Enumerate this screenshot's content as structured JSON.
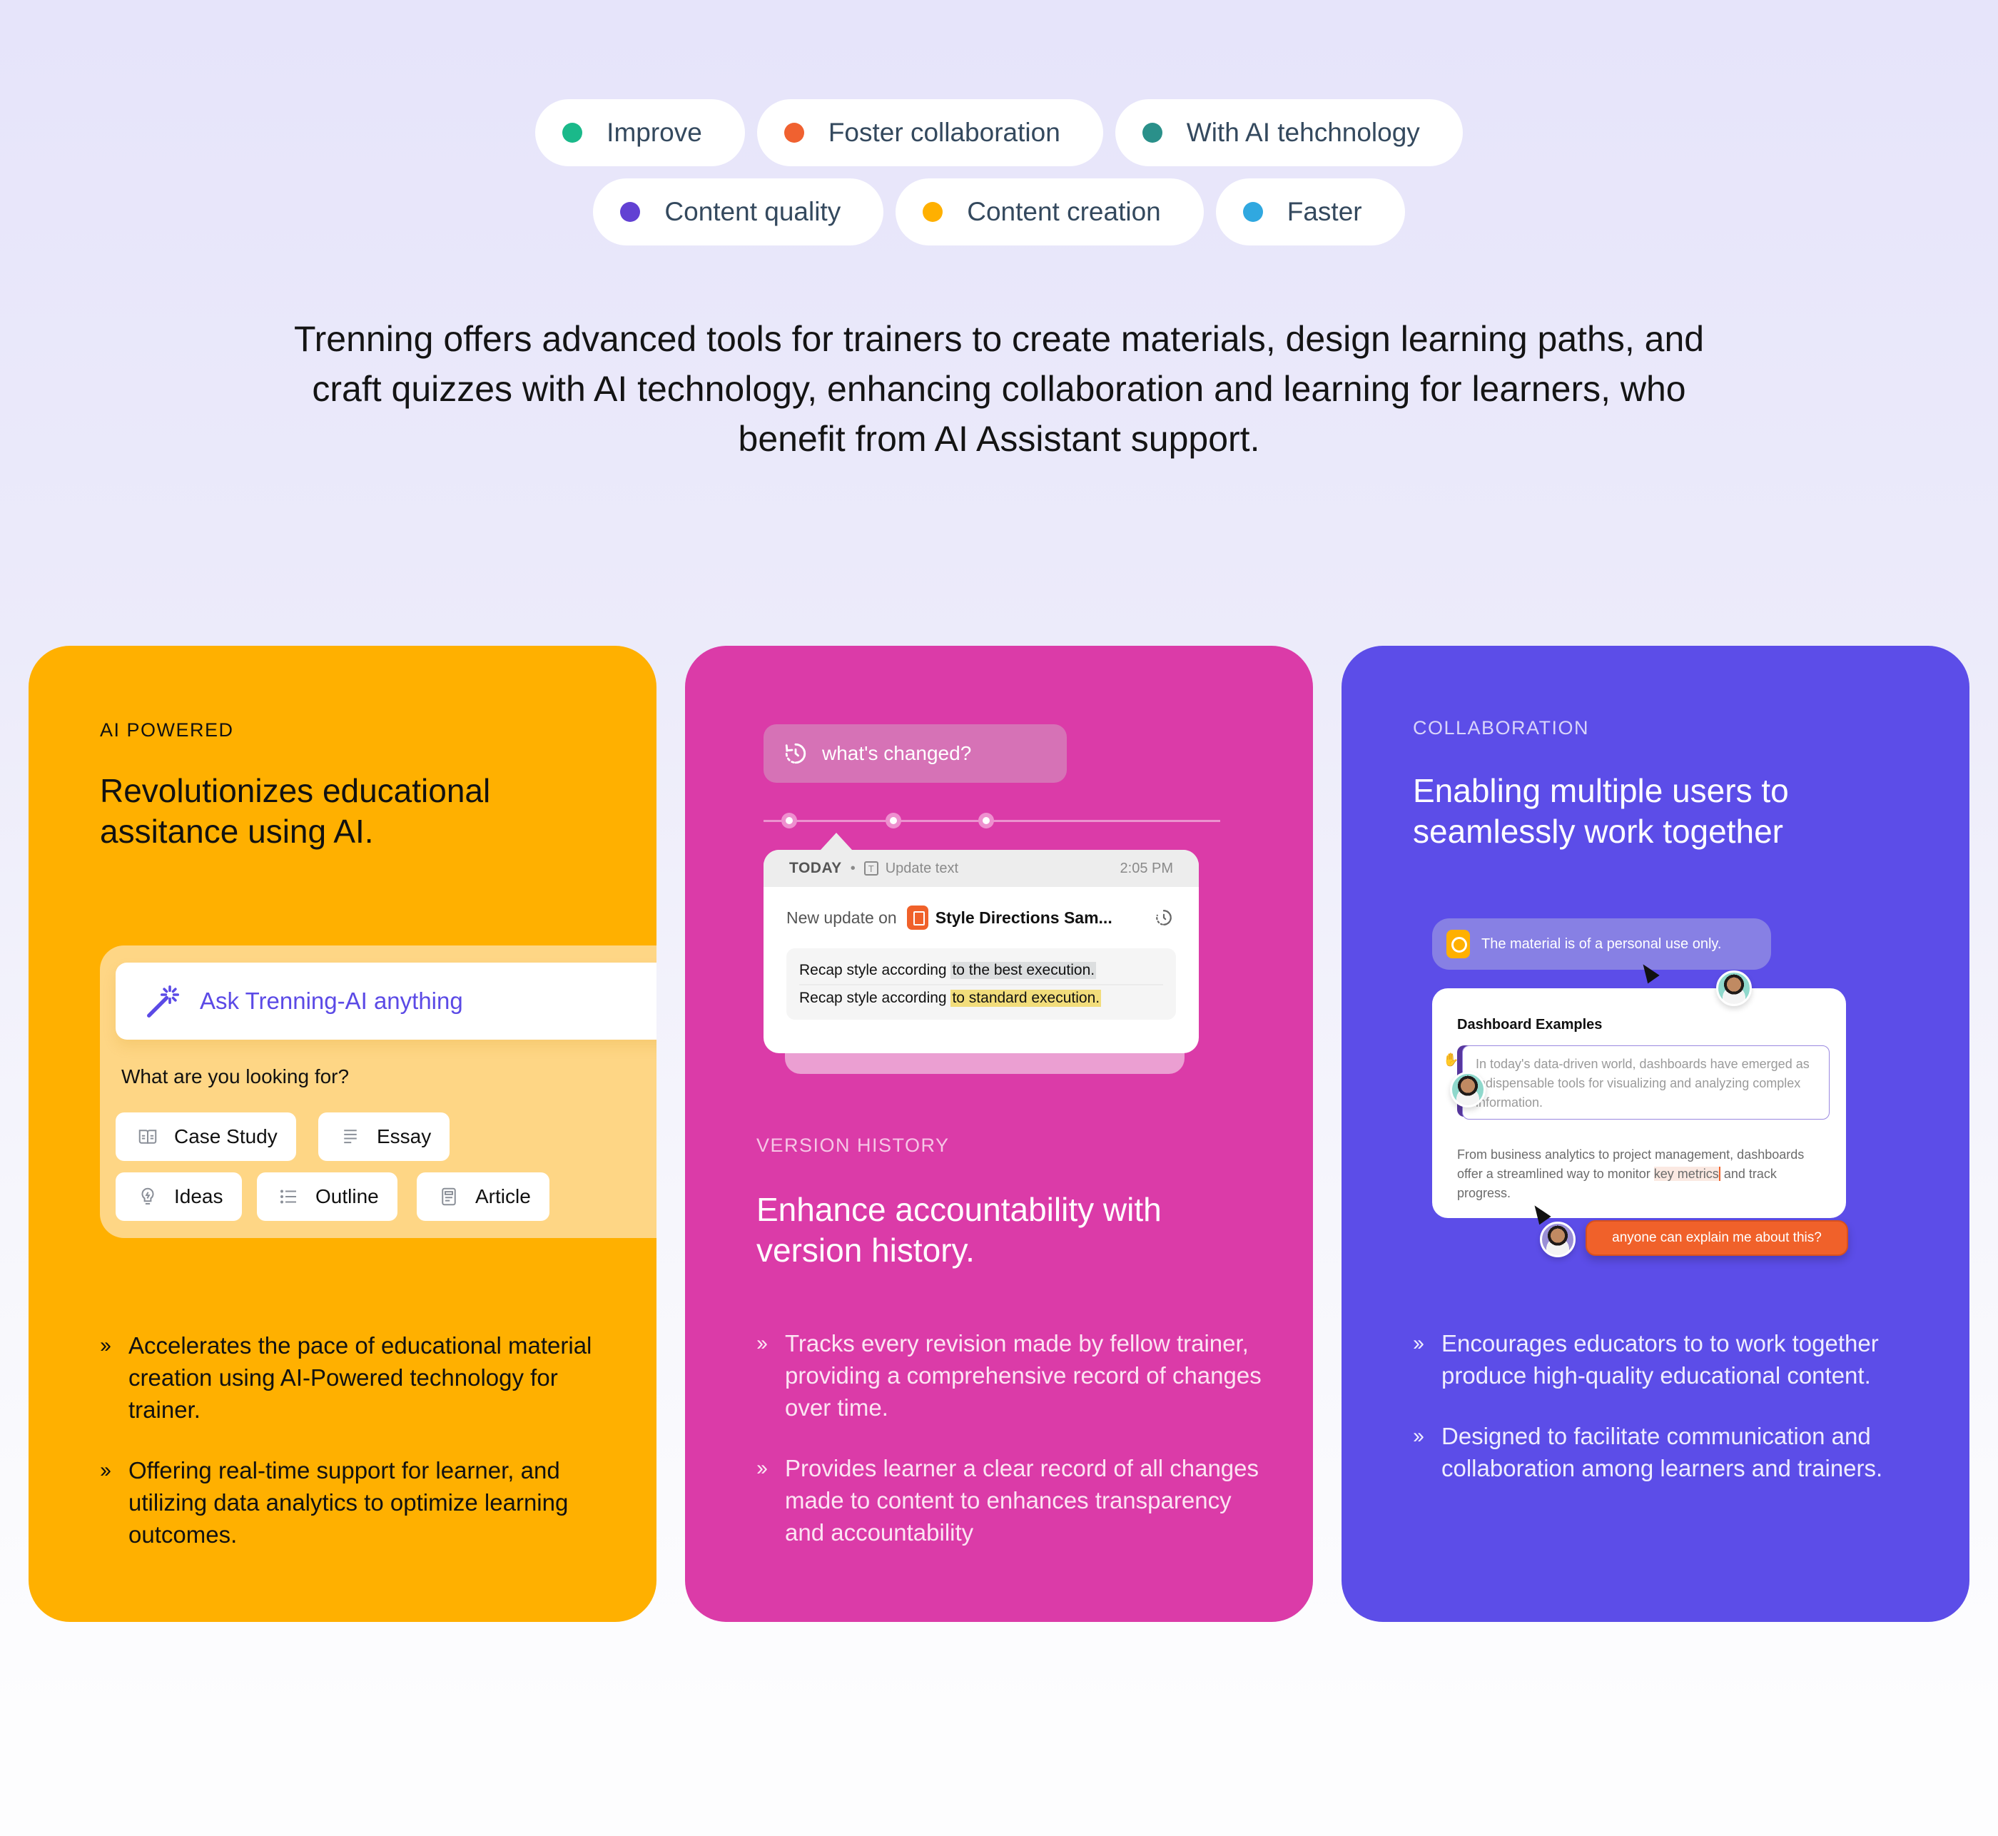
{
  "tags": {
    "row1": [
      {
        "label": "Improve",
        "color": "#1AB98A"
      },
      {
        "label": "Foster collaboration",
        "color": "#F06130"
      },
      {
        "label": "With AI tehchnology",
        "color": "#2A908A"
      }
    ],
    "row2": [
      {
        "label": "Content quality",
        "color": "#6241D3"
      },
      {
        "label": "Content creation",
        "color": "#FFB000"
      },
      {
        "label": "Faster",
        "color": "#30A8E0"
      }
    ]
  },
  "intro": "Trenning offers advanced tools for trainers to create materials, design learning paths, and craft quizzes with AI technology, enhancing collaboration and learning for learners, who benefit from AI Assistant support.",
  "cards": {
    "ai": {
      "color": "#FFB000",
      "eyebrow": "AI POWERED",
      "headline": "Revolutionizes educational assitance using AI.",
      "input_placeholder": "Ask Trenning-AI anything",
      "question": "What are you looking for?",
      "chips": [
        "Case Study",
        "Essay",
        "Ideas",
        "Outline",
        "Article"
      ],
      "bullets": [
        "Accelerates the pace of educational material creation using AI-Powered technology for trainer.",
        "Offering real-time support for learner, and utilizing data analytics to optimize learning outcomes."
      ]
    },
    "version": {
      "color": "#DB3BA8",
      "whats_changed": "what's changed?",
      "entry": {
        "day": "TODAY",
        "action": "Update text",
        "time": "2:05 PM",
        "prefix": "New update on",
        "doc_title": "Style Directions Sam...",
        "old_base": "Recap style according ",
        "old_highlight": "to the best execution.",
        "new_base": "Recap style according ",
        "new_highlight": "to standard execution."
      },
      "eyebrow": "VERSION HISTORY",
      "headline": "Enhance accountability with version history.",
      "bullets": [
        "Tracks every revision made by fellow trainer, providing a comprehensive record of changes over time.",
        "Provides learner a clear record of all changes made to content to enhances transparency and accountability"
      ]
    },
    "collab": {
      "color": "#5C4DE8",
      "eyebrow": "COLLABORATION",
      "headline": "Enabling multiple users to seamlessly work together",
      "notice": "The material is of a personal use only.",
      "doc_title": "Dashboard Examples",
      "quote": "In today's data-driven world, dashboards have emerged as indispensable tools for visualizing and analyzing complex information.",
      "para_before": "From business analytics to project management, dashboards offer a streamlined way to monitor ",
      "para_highlight": "key metrics",
      "para_after": " and track progress.",
      "comment": "anyone can explain me about this?",
      "bullets": [
        "Encourages educators to to work together produce high-quality educational content.",
        "Designed to facilitate communication and collaboration among learners and trainers."
      ]
    }
  }
}
